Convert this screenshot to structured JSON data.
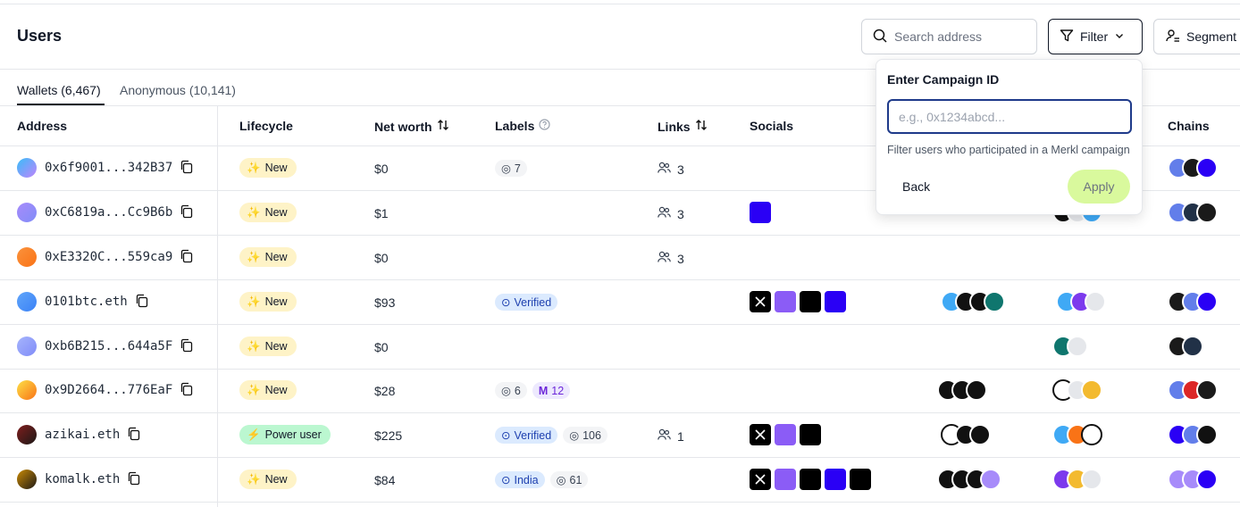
{
  "header": {
    "title": "Users",
    "search_placeholder": "Search address",
    "filter_label": "Filter",
    "segment_label": "Segment"
  },
  "tabs": [
    {
      "label": "Wallets (6,467)",
      "active": true
    },
    {
      "label": "Anonymous (10,141)",
      "active": false
    }
  ],
  "columns": {
    "address": "Address",
    "lifecycle": "Lifecycle",
    "net_worth": "Net worth",
    "labels": "Labels",
    "links": "Links",
    "socials": "Socials",
    "chains": "Chains"
  },
  "rows": [
    {
      "address": "0x6f9001...342B37",
      "lifecycle": "New",
      "net_worth": "$0",
      "labels": [
        {
          "text": "7",
          "style": "gray"
        }
      ],
      "links": "3"
    },
    {
      "address": "0xC6819a...Cc9B6b",
      "lifecycle": "New",
      "net_worth": "$1",
      "labels": [],
      "links": "3"
    },
    {
      "address": "0xE3320C...559ca9",
      "lifecycle": "New",
      "net_worth": "$0",
      "labels": [],
      "links": "3"
    },
    {
      "address": "0101btc.eth",
      "lifecycle": "New",
      "net_worth": "$93",
      "labels": [
        {
          "text": "Verified",
          "style": "blue"
        }
      ],
      "links": ""
    },
    {
      "address": "0xb6B215...644a5F",
      "lifecycle": "New",
      "net_worth": "$0",
      "labels": [],
      "links": ""
    },
    {
      "address": "0x9D2664...776EaF",
      "lifecycle": "New",
      "net_worth": "$28",
      "labels": [
        {
          "text": "6",
          "style": "gray"
        },
        {
          "text": "12",
          "style": "purple"
        }
      ],
      "links": ""
    },
    {
      "address": "azikai.eth",
      "lifecycle": "Power user",
      "net_worth": "$225",
      "labels": [
        {
          "text": "Verified",
          "style": "blue"
        },
        {
          "text": "106",
          "style": "gray"
        }
      ],
      "links": "1"
    },
    {
      "address": "komalk.eth",
      "lifecycle": "New",
      "net_worth": "$84",
      "labels": [
        {
          "text": "India",
          "style": "blue"
        },
        {
          "text": "61",
          "style": "gray"
        }
      ],
      "links": ""
    }
  ],
  "popover": {
    "title": "Enter Campaign ID",
    "input_value": "",
    "input_placeholder": "e.g., 0x1234abcd...",
    "help": "Filter users who participated in a Merkl campaign",
    "back_label": "Back",
    "apply_label": "Apply"
  },
  "colors": {
    "new_badge": "#fef3c7",
    "power_badge": "#bbf7d0",
    "apply_button": "#d9f99d",
    "input_focus": "#1e3a8a"
  }
}
